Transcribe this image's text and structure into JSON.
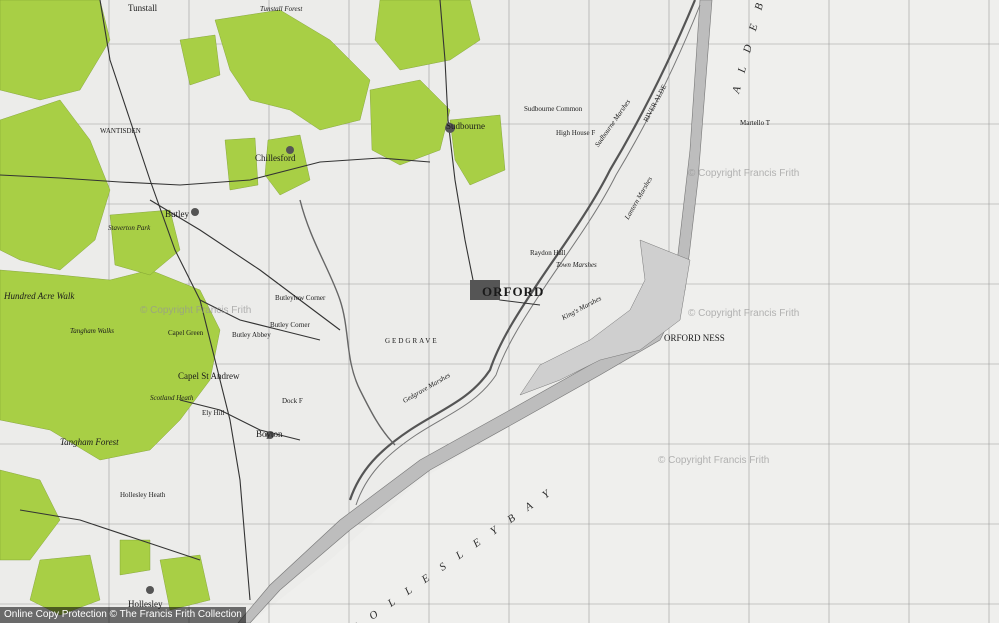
{
  "labels": {
    "tunstall": "Tunstall",
    "tunstall_forest": "Tunstall Forest",
    "sudbourne": "Sudbourne",
    "chillesford": "Chillesford",
    "wantisden": "WANTISDEN",
    "butley": "Butley",
    "staverton_park": "Staverton Park",
    "hundred_acre_walk": "Hundred Acre Walk",
    "tangham_walks": "Tangham Walks",
    "capel_green": "Capel Green",
    "capel_st_andrew": "Capel St Andrew",
    "scotland_heath": "Scotland Heath",
    "tangham_forest": "Tangham Forest",
    "boyton": "Boyton",
    "hollesley": "Hollesley",
    "hollesley_heath": "Hollesley Heath",
    "orford": "ORFORD",
    "orford_ness": "ORFORD NESS",
    "kings_marshes": "King's Marshes",
    "gedgrave": "GEDGRAVE",
    "gedgrave_marshes": "Gedgrave Marshes",
    "river_alde": "RIVER ALDE",
    "sudbourne_marshes": "Sudbourne Marshes",
    "lanter_marshes": "Lantern Marshes",
    "town_marshes": "Town Marshes",
    "raydon_hall": "Raydon Hall",
    "high_house": "High House F",
    "sudbourne_common": "Sudbourne Common",
    "hollesley_bay": "H O L L E S L E Y   B A Y",
    "aldeburgh_bay": "A L D E B",
    "butley_abbey": "Butley Abbey",
    "butley_corner": "Butley Corner",
    "butleylow_corner": "Butleylow Corner",
    "dock_farm": "Dock F",
    "eyke_hill": "Ely Hill",
    "martello": "Martello T"
  },
  "watermarks": {
    "mark1": "© Copyright Francis Frith",
    "mark2": "© Copyright Francis Frith",
    "mark3": "© Copyright Francis Frith",
    "mark4": "© Copyright Francis Frith"
  },
  "copyright": "Online Copy Protection © The Francis Frith Collection",
  "colors": {
    "woodland": "#a8cf45",
    "land": "#ececea",
    "sea": "#ececea",
    "road": "#333333",
    "grid": "#9a9a9a",
    "shingle": "#b8b8b8"
  }
}
